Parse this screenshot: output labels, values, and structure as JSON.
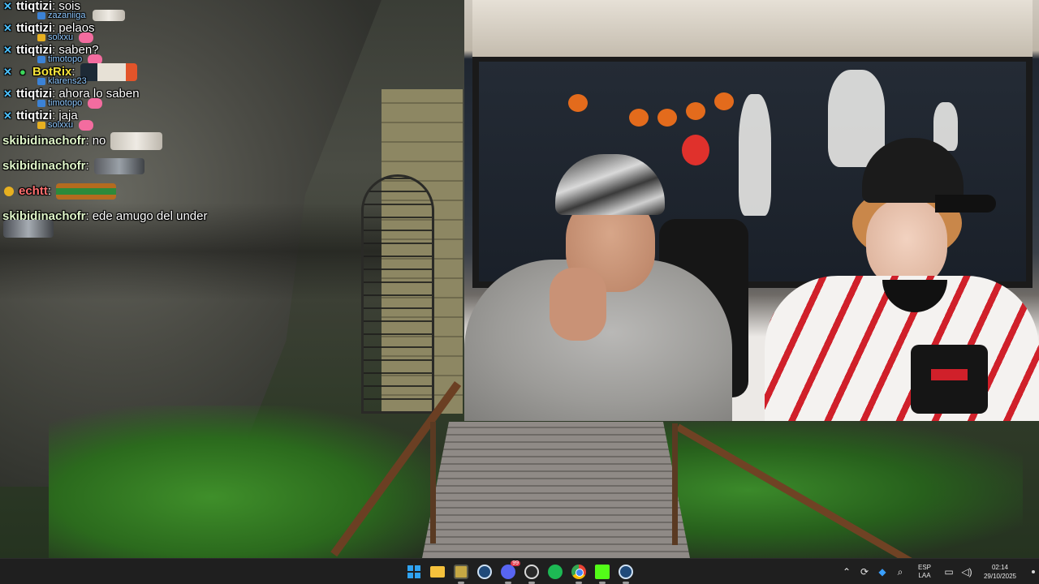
{
  "chat": {
    "messages": [
      {
        "user": "ttiqtizi",
        "text": "sois",
        "sub": "zazaniiga"
      },
      {
        "user": "ttiqtizi",
        "text": "pelaos",
        "sub": "solxxu"
      },
      {
        "user": "ttiqtizi",
        "text": "saben?",
        "sub": "timotopo"
      },
      {
        "user": "BotRix",
        "text": "",
        "sub": "klarens23"
      },
      {
        "user": "ttiqtizi",
        "text": "ahora lo saben",
        "sub": "timotopo"
      },
      {
        "user": "ttiqtizi",
        "text": "jaja",
        "sub": "solxxu"
      },
      {
        "user": "skibidinachofr",
        "text": "no"
      },
      {
        "user": "skibidinachofr",
        "text": ""
      },
      {
        "user": "echtt",
        "text": ""
      },
      {
        "user": "skibidinachofr",
        "text": "ede amugo del under"
      }
    ],
    "colors": {
      "ttiqtizi": "#ffffff",
      "BotRix": "#f7e43b",
      "skibidinachofr": "#dff5c8",
      "echtt": "#ff6f6f",
      "sub_text": "#8ec8ff"
    },
    "icons": {
      "mod": "sword-icon",
      "bot": "bot-badge-icon",
      "coin": "coin-badge-icon"
    }
  },
  "taskbar": {
    "apps": [
      {
        "name": "start-icon"
      },
      {
        "name": "file-explorer-icon"
      },
      {
        "name": "app-icon"
      },
      {
        "name": "steam-icon"
      },
      {
        "name": "discord-icon",
        "badge": "99"
      },
      {
        "name": "obs-icon"
      },
      {
        "name": "spotify-icon"
      },
      {
        "name": "chrome-icon"
      },
      {
        "name": "kick-icon"
      },
      {
        "name": "steam-icon"
      }
    ],
    "tray": {
      "language_top": "ESP",
      "language_bottom": "LAA",
      "time": "02:14",
      "date": "29/10/2025",
      "icons": [
        "chevron-up-icon",
        "sync-icon",
        "security-icon",
        "mic-icon",
        "network-icon",
        "volume-icon"
      ]
    }
  }
}
